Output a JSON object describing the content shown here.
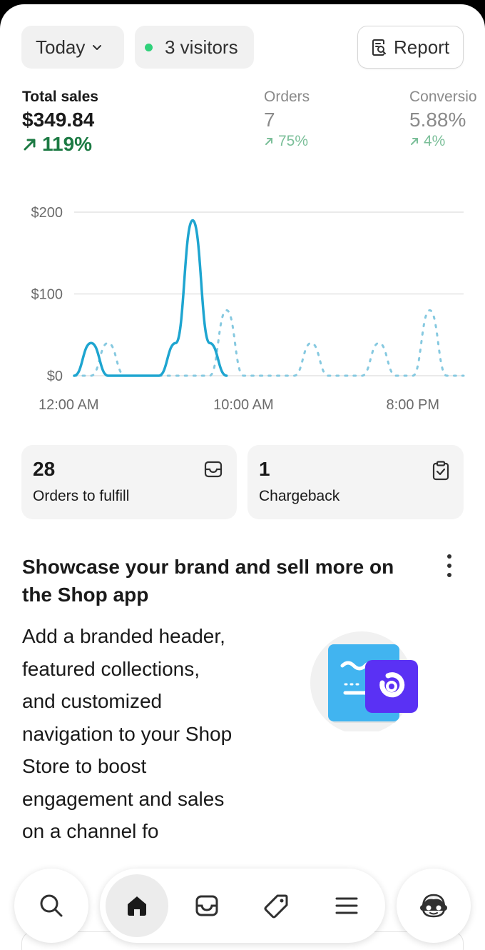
{
  "filters": {
    "date_label": "Today",
    "visitors_label": "3 visitors",
    "visitors_dot_color": "#2fd17a",
    "report_label": "Report"
  },
  "metrics": {
    "sales": {
      "label": "Total sales",
      "value": "$349.84",
      "delta": "119%"
    },
    "orders": {
      "label": "Orders",
      "value": "7",
      "delta": "75%"
    },
    "conversion": {
      "label": "Conversio",
      "value": "5.88%",
      "delta": "4%"
    }
  },
  "chart_data": {
    "type": "line",
    "y_ticks": [
      "$200",
      "$100",
      "$0"
    ],
    "x_tick_labels": [
      "12:00 AM",
      "10:00 AM",
      "8:00 PM"
    ],
    "ylim": [
      0,
      200
    ],
    "grid": true,
    "series": [
      {
        "style": "solid",
        "color": "#1ea5d0",
        "points": [
          [
            0,
            0
          ],
          [
            1,
            40
          ],
          [
            2,
            0
          ],
          [
            3,
            0
          ],
          [
            4,
            0
          ],
          [
            5,
            0
          ],
          [
            6,
            40
          ],
          [
            7,
            190
          ],
          [
            8,
            40
          ],
          [
            9,
            0
          ]
        ]
      },
      {
        "style": "dotted",
        "color": "#86c9e0",
        "points": [
          [
            0,
            0
          ],
          [
            1,
            0
          ],
          [
            2,
            40
          ],
          [
            3,
            0
          ],
          [
            4,
            0
          ],
          [
            5,
            0
          ],
          [
            6,
            0
          ],
          [
            7,
            0
          ],
          [
            8,
            0
          ],
          [
            9,
            80
          ],
          [
            10,
            0
          ],
          [
            11,
            0
          ],
          [
            12,
            0
          ],
          [
            13,
            0
          ],
          [
            14,
            40
          ],
          [
            15,
            0
          ],
          [
            16,
            0
          ],
          [
            17,
            0
          ],
          [
            18,
            40
          ],
          [
            19,
            0
          ],
          [
            20,
            0
          ],
          [
            21,
            80
          ],
          [
            22,
            0
          ],
          [
            23,
            0
          ]
        ]
      }
    ]
  },
  "cards": {
    "fulfill": {
      "count": "28",
      "label": "Orders to fulfill",
      "icon": "inbox-icon"
    },
    "chargeback": {
      "count": "1",
      "label": "Chargeback",
      "icon": "clipboard-check-icon"
    }
  },
  "promo": {
    "title": "Showcase your brand and sell more on the Shop app",
    "body": "Add a branded header, featured collections, and customized navigation to your Shop Store to boost engagement and sales on a channel fo",
    "art_colors": {
      "card": "#41b4f0",
      "badge": "#5a31f4"
    }
  },
  "nav": {
    "search_icon": "search-icon",
    "home_icon": "home-icon",
    "orders_icon": "inbox-icon",
    "products_icon": "tag-icon",
    "menu_icon": "menu-icon",
    "avatar_icon": "avatar-icon"
  }
}
